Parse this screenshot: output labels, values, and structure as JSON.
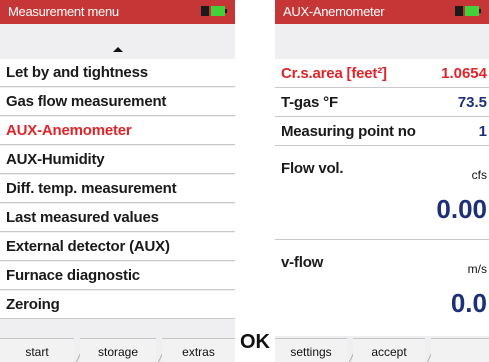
{
  "left_screen": {
    "title": "Measurement menu",
    "menu_items": [
      "Let by and tightness",
      "Gas flow measurement",
      "AUX-Anemometer",
      "AUX-Humidity",
      "Diff. temp. measurement",
      "Last measured values",
      "External detector (AUX)",
      "Furnace diagnostic",
      "Zeroing"
    ],
    "selected_item": "AUX-Anemometer",
    "tabs": [
      "start",
      "storage",
      "extras"
    ]
  },
  "ok_button": {
    "label": "OK"
  },
  "right_screen": {
    "title": "AUX-Anemometer",
    "rows": [
      {
        "label": "Cr.s.area [feet²]",
        "value": "1.0654"
      },
      {
        "label": "T-gas °F",
        "value": "73.5"
      },
      {
        "label": "Measuring point no",
        "value": "1"
      }
    ],
    "flow_vol": {
      "label": "Flow vol.",
      "unit": "cfs",
      "value": "0.00"
    },
    "v_flow": {
      "label": "v-flow",
      "unit": "m/s",
      "value": "0.0"
    },
    "tabs": [
      "settings",
      "accept"
    ]
  },
  "colors": {
    "titlebar": "#c73636",
    "highlight": "#e0242a",
    "value_blue": "#1e2f7a",
    "battery_green": "#42d13a"
  }
}
